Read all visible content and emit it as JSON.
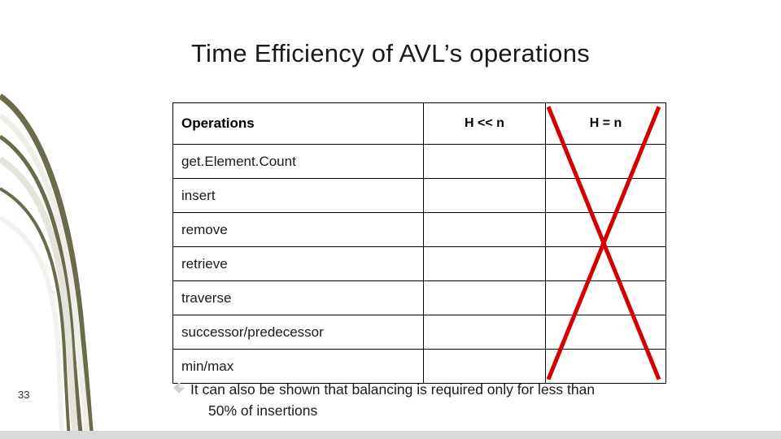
{
  "slide": {
    "title": "Time Efficiency of  AVL’s operations",
    "slide_number": "33",
    "accent_color": "#6b6a4c",
    "cross_color": "#d40000",
    "bullet_marker_color": "#bfbfbf",
    "bottom_bar_color": "#d9d9d9"
  },
  "table": {
    "headers": [
      "Operations",
      "H << n",
      "H = n"
    ],
    "rows": [
      {
        "operation": "get.Element.Count",
        "h_ll_n": "",
        "h_eq_n": ""
      },
      {
        "operation": "insert",
        "h_ll_n": "",
        "h_eq_n": ""
      },
      {
        "operation": "remove",
        "h_ll_n": "",
        "h_eq_n": ""
      },
      {
        "operation": "retrieve",
        "h_ll_n": "",
        "h_eq_n": ""
      },
      {
        "operation": "traverse",
        "h_ll_n": "",
        "h_eq_n": ""
      },
      {
        "operation": "successor/predecessor",
        "h_ll_n": "",
        "h_eq_n": ""
      },
      {
        "operation": "min/max",
        "h_ll_n": "",
        "h_eq_n": ""
      }
    ]
  },
  "bullet": {
    "line1": "It can also be shown that balancing is required only for less than",
    "line2": "50% of insertions"
  }
}
